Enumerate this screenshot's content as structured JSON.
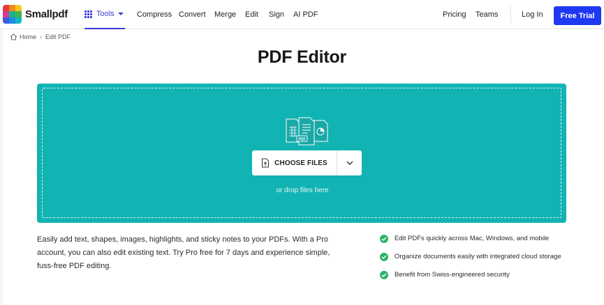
{
  "header": {
    "logo_text": "Smallpdf",
    "tools_label": "Tools",
    "nav": [
      "Compress",
      "Convert",
      "Merge",
      "Edit",
      "Sign",
      "AI PDF"
    ],
    "right_links": [
      "Pricing",
      "Teams"
    ],
    "login_label": "Log In",
    "trial_label": "Free Trial",
    "accent_color": "#1f38f2",
    "tools_color": "#3a3ad6"
  },
  "breadcrumb": {
    "home": "Home",
    "current": "Edit PDF"
  },
  "main": {
    "title": "PDF Editor",
    "dropzone": {
      "background_color": "#11b4b3",
      "choose_label": "CHOOSE FILES",
      "drop_hint": "or drop files here",
      "illustration_badge": "PDF"
    },
    "description": "Easily add text, shapes, images, highlights, and sticky notes to your PDFs. With a Pro account, you can also edit existing text. Try Pro free for 7 days and experience simple, fuss-free PDF editing.",
    "features": [
      "Edit PDFs quickly across Mac, Windows, and mobile",
      "Organize documents easily with integrated cloud storage",
      "Benefit from Swiss-engineered security"
    ],
    "check_color": "#2bb36a"
  }
}
